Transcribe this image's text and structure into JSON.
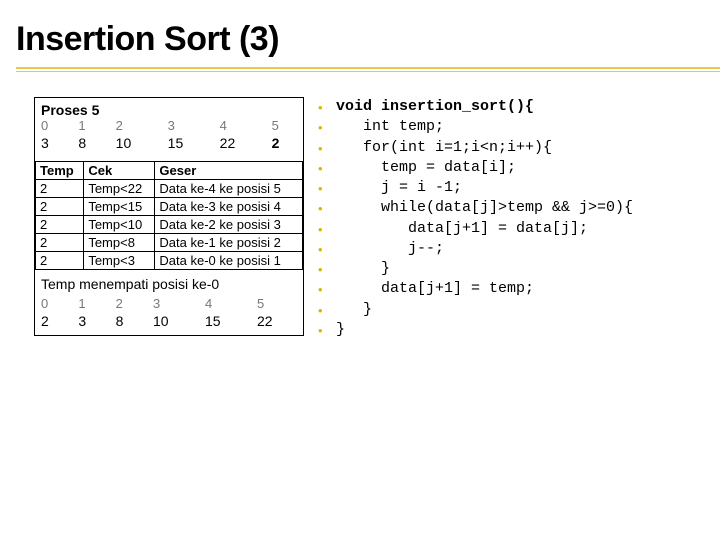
{
  "title": "Insertion Sort (3)",
  "figure": {
    "proses_label": "Proses 5",
    "top_indices": [
      "0",
      "1",
      "2",
      "3",
      "4",
      "5"
    ],
    "top_values": [
      "3",
      "8",
      "10",
      "15",
      "22",
      "2"
    ],
    "steps_header": [
      "Temp",
      "Cek",
      "Geser"
    ],
    "steps_rows": [
      [
        "2",
        "Temp<22",
        "Data ke-4 ke posisi 5"
      ],
      [
        "2",
        "Temp<15",
        "Data ke-3 ke posisi 4"
      ],
      [
        "2",
        "Temp<10",
        "Data ke-2 ke posisi 3"
      ],
      [
        "2",
        "Temp<8",
        "Data ke-1 ke posisi 2"
      ],
      [
        "2",
        "Temp<3",
        "Data ke-0 ke posisi 1"
      ]
    ],
    "temp_text": "Temp menempati posisi ke-0",
    "bottom_indices": [
      "0",
      "1",
      "2",
      "3",
      "4",
      "5"
    ],
    "bottom_values": [
      "2",
      "3",
      "8",
      "10",
      "15",
      "22"
    ]
  },
  "code_lines": [
    {
      "text": "void insertion_sort(){",
      "bold": true
    },
    {
      "text": "   int temp;",
      "bold": false
    },
    {
      "text": "   for(int i=1;i<n;i++){",
      "bold": false
    },
    {
      "text": "     temp = data[i];",
      "bold": false
    },
    {
      "text": "     j = i -1;",
      "bold": false
    },
    {
      "text": "     while(data[j]>temp && j>=0){",
      "bold": false
    },
    {
      "text": "        data[j+1] = data[j];",
      "bold": false
    },
    {
      "text": "        j--;",
      "bold": false
    },
    {
      "text": "     }",
      "bold": false
    },
    {
      "text": "     data[j+1] = temp;",
      "bold": false
    },
    {
      "text": "   }",
      "bold": false
    },
    {
      "text": "}",
      "bold": false
    }
  ]
}
